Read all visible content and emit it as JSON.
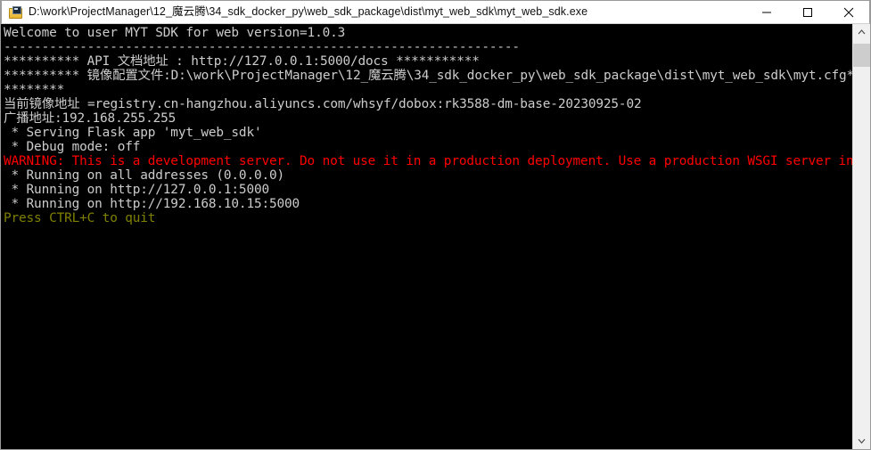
{
  "window": {
    "title": "D:\\work\\ProjectManager\\12_魔云腾\\34_sdk_docker_py\\web_sdk_package\\dist\\myt_web_sdk\\myt_web_sdk.exe",
    "icon": "console-app-icon",
    "controls": {
      "minimize_label": "Minimize",
      "maximize_label": "Maximize",
      "close_label": "Close"
    }
  },
  "console": {
    "background_color": "#000000",
    "foreground_color": "#cccccc",
    "warning_color": "#ff0000",
    "hint_color": "#808000",
    "lines": [
      {
        "text": "Welcome to user MYT SDK for web version=1.0.3",
        "color": "white"
      },
      {
        "text": "--------------------------------------------------------------------",
        "color": "white"
      },
      {
        "text": "********** API 文档地址 : http://127.0.0.1:5000/docs ***********",
        "color": "white"
      },
      {
        "text": "********** 镜像配置文件:D:\\work\\ProjectManager\\12_魔云腾\\34_sdk_docker_py\\web_sdk_package\\dist\\myt_web_sdk\\myt.cfg*******",
        "color": "white"
      },
      {
        "text": "********",
        "color": "white"
      },
      {
        "text": "当前镜像地址 =registry.cn-hangzhou.aliyuncs.com/whsyf/dobox:rk3588-dm-base-20230925-02",
        "color": "white"
      },
      {
        "text": "广播地址:192.168.255.255",
        "color": "white"
      },
      {
        "text": " * Serving Flask app 'myt_web_sdk'",
        "color": "white"
      },
      {
        "text": " * Debug mode: off",
        "color": "white"
      },
      {
        "text": "WARNING: This is a development server. Do not use it in a production deployment. Use a production WSGI server instead.",
        "color": "red"
      },
      {
        "text": " * Running on all addresses (0.0.0.0)",
        "color": "white"
      },
      {
        "text": " * Running on http://127.0.0.1:5000",
        "color": "white"
      },
      {
        "text": " * Running on http://192.168.10.15:5000",
        "color": "white"
      },
      {
        "text": "Press CTRL+C to quit",
        "color": "olive"
      }
    ]
  },
  "scrollbar": {
    "up_label": "Scroll up",
    "down_label": "Scroll down",
    "thumb_label": "Scroll thumb"
  }
}
